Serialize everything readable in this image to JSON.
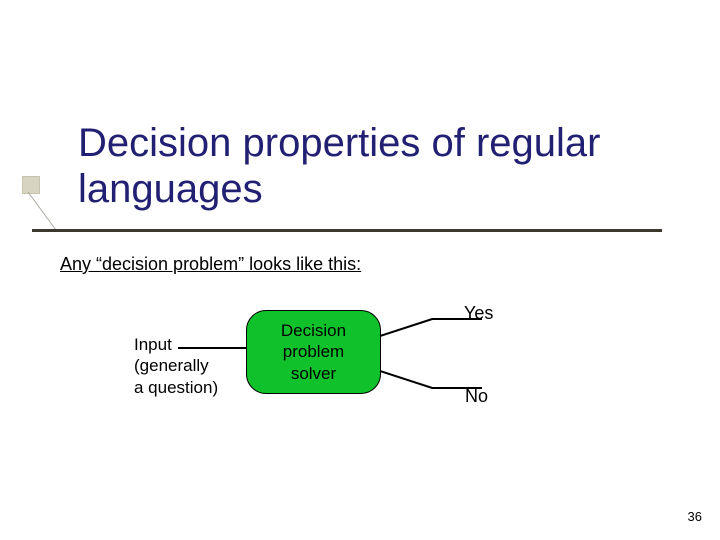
{
  "title": "Decision properties of regular languages",
  "subheading": "Any “decision problem” looks like this:",
  "diagram": {
    "input_label": "Input\n(generally\na question)",
    "solver_label": "Decision\nproblem\nsolver",
    "yes": "Yes",
    "no": "No"
  },
  "slide_number": "36"
}
